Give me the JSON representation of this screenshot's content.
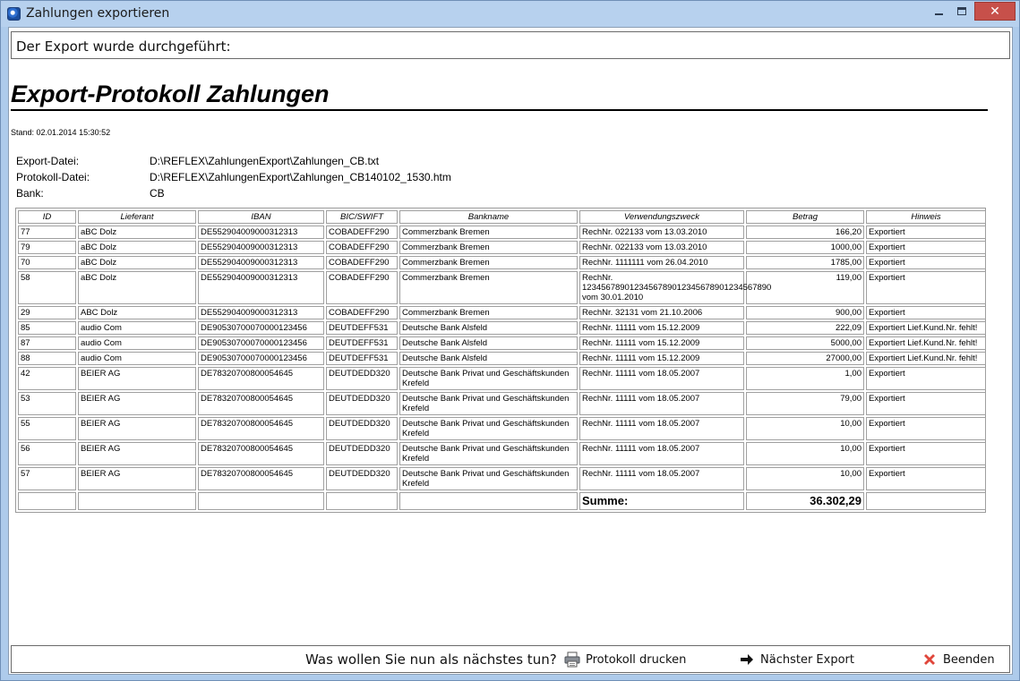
{
  "window": {
    "title": "Zahlungen exportieren",
    "close_glyph": "✕",
    "icons": {
      "app": "app-icon",
      "minimize": "minimize-icon",
      "maximize": "maximize-icon",
      "close": "close-icon"
    }
  },
  "status": {
    "message": "Der Export wurde durchgeführt:"
  },
  "report": {
    "title": "Export-Protokoll Zahlungen",
    "stand": "Stand: 02.01.2014 15:30:52",
    "meta": [
      {
        "label": "Export-Datei:",
        "value": "D:\\REFLEX\\ZahlungenExport\\Zahlungen_CB.txt"
      },
      {
        "label": "Protokoll-Datei:",
        "value": "D:\\REFLEX\\ZahlungenExport\\Zahlungen_CB140102_1530.htm"
      },
      {
        "label": "Bank:",
        "value": "CB"
      }
    ],
    "columns": [
      "ID",
      "Lieferant",
      "IBAN",
      "BIC/SWIFT",
      "Bankname",
      "Verwendungszweck",
      "Betrag",
      "Hinweis"
    ],
    "rows": [
      [
        "77",
        "aBC Dolz",
        "DE552904009000312313",
        "COBADEFF290",
        "Commerzbank Bremen",
        "RechNr. 022133 vom 13.03.2010",
        "166,20",
        "Exportiert"
      ],
      [
        "79",
        "aBC Dolz",
        "DE552904009000312313",
        "COBADEFF290",
        "Commerzbank Bremen",
        "RechNr. 022133 vom 13.03.2010",
        "1000,00",
        "Exportiert"
      ],
      [
        "70",
        "aBC Dolz",
        "DE552904009000312313",
        "COBADEFF290",
        "Commerzbank Bremen",
        "RechNr. 1111111 vom 26.04.2010",
        "1785,00",
        "Exportiert"
      ],
      [
        "58",
        "aBC Dolz",
        "DE552904009000312313",
        "COBADEFF290",
        "Commerzbank Bremen",
        "RechNr. 1234567890123456789012345678901234567890 vom 30.01.2010",
        "119,00",
        "Exportiert"
      ],
      [
        "29",
        "ABC Dolz",
        "DE552904009000312313",
        "COBADEFF290",
        "Commerzbank Bremen",
        "RechNr. 32131 vom 21.10.2006",
        "900,00",
        "Exportiert"
      ],
      [
        "85",
        "audio Com",
        "DE90530700070000123456",
        "DEUTDEFF531",
        "Deutsche Bank Alsfeld",
        "RechNr. 11111 vom 15.12.2009",
        "222,09",
        "Exportiert Lief.Kund.Nr. fehlt!"
      ],
      [
        "87",
        "audio Com",
        "DE90530700070000123456",
        "DEUTDEFF531",
        "Deutsche Bank Alsfeld",
        "RechNr. 11111 vom 15.12.2009",
        "5000,00",
        "Exportiert Lief.Kund.Nr. fehlt!"
      ],
      [
        "88",
        "audio Com",
        "DE90530700070000123456",
        "DEUTDEFF531",
        "Deutsche Bank Alsfeld",
        "RechNr. 11111 vom 15.12.2009",
        "27000,00",
        "Exportiert Lief.Kund.Nr. fehlt!"
      ],
      [
        "42",
        "BEIER AG",
        "DE78320700800054645",
        "DEUTDEDD320",
        "Deutsche Bank Privat und Geschäftskunden Krefeld",
        "RechNr. 11111 vom 18.05.2007",
        "1,00",
        "Exportiert"
      ],
      [
        "53",
        "BEIER AG",
        "DE78320700800054645",
        "DEUTDEDD320",
        "Deutsche Bank Privat und Geschäftskunden Krefeld",
        "RechNr. 11111 vom 18.05.2007",
        "79,00",
        "Exportiert"
      ],
      [
        "55",
        "BEIER AG",
        "DE78320700800054645",
        "DEUTDEDD320",
        "Deutsche Bank Privat und Geschäftskunden Krefeld",
        "RechNr. 11111 vom 18.05.2007",
        "10,00",
        "Exportiert"
      ],
      [
        "56",
        "BEIER AG",
        "DE78320700800054645",
        "DEUTDEDD320",
        "Deutsche Bank Privat und Geschäftskunden Krefeld",
        "RechNr. 11111 vom 18.05.2007",
        "10,00",
        "Exportiert"
      ],
      [
        "57",
        "BEIER AG",
        "DE78320700800054645",
        "DEUTDEDD320",
        "Deutsche Bank Privat und Geschäftskunden Krefeld",
        "RechNr. 11111 vom 18.05.2007",
        "10,00",
        "Exportiert"
      ]
    ],
    "sum_label": "Summe:",
    "sum_value": "36.302,29"
  },
  "footer": {
    "question": "Was wollen Sie nun als nächstes tun?",
    "print_label": "Protokoll drucken",
    "next_label": "Nächster Export",
    "quit_label": "Beenden",
    "icons": {
      "print": "printer-icon",
      "next": "arrow-right-icon",
      "quit": "close-x-icon"
    },
    "colors": {
      "quit_icon": "#e0463b"
    }
  }
}
